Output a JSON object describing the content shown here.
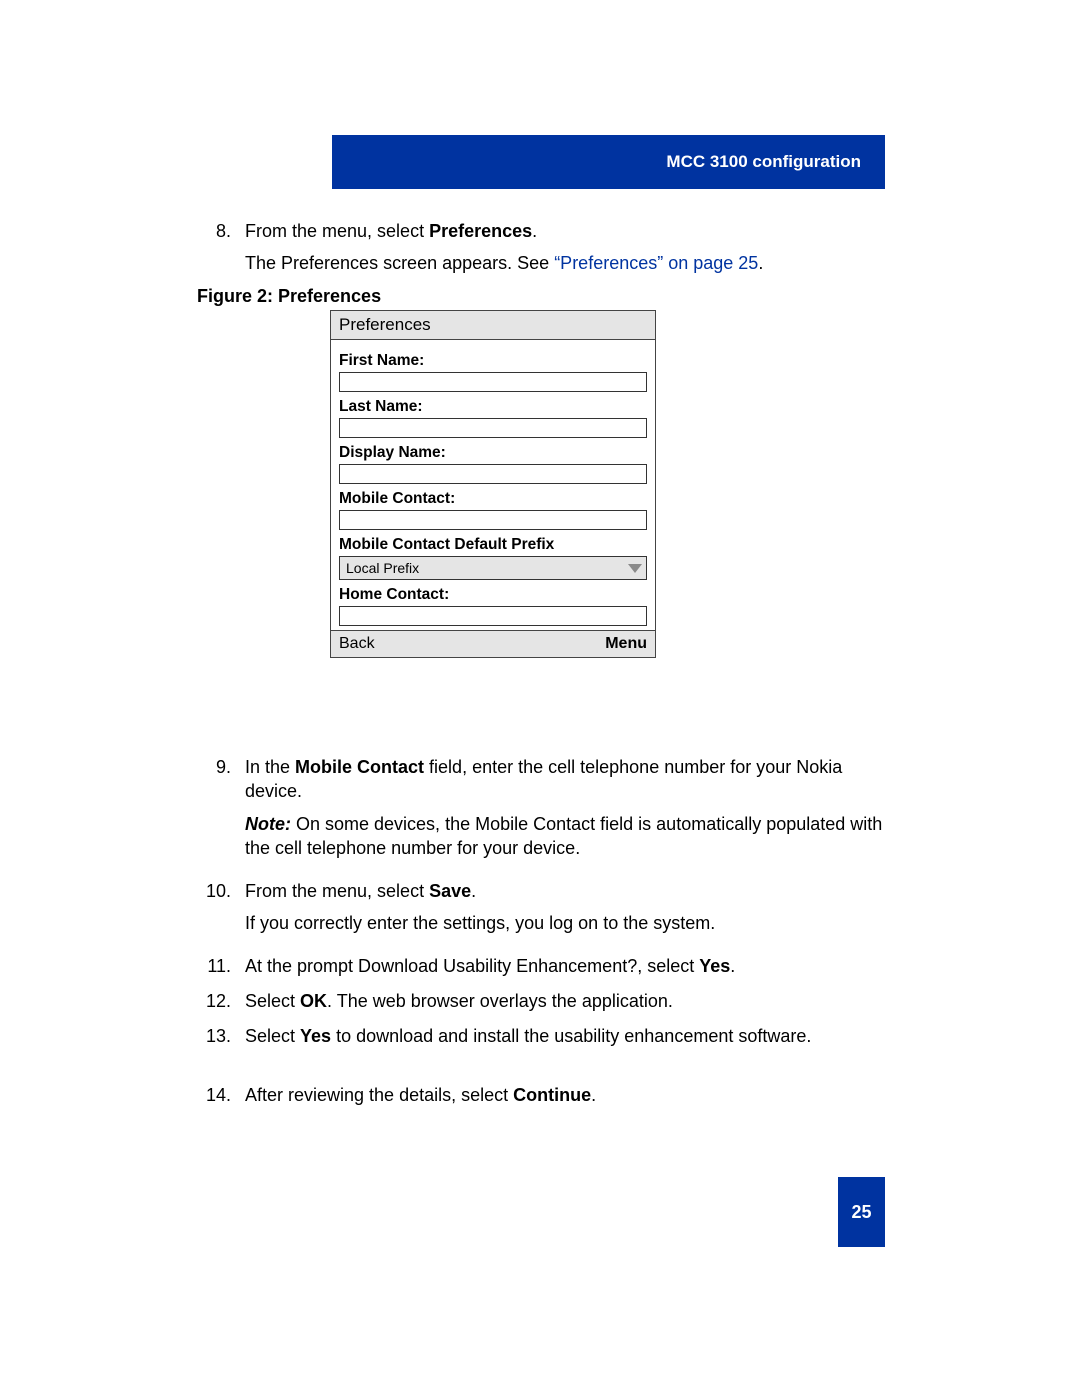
{
  "header": {
    "title": "MCC 3100 configuration"
  },
  "page_number": "25",
  "step8": {
    "num": "8.",
    "text_a": "From the menu, select ",
    "text_b": "Preferences",
    "text_c": ".",
    "sub_a": "The Preferences screen appears. See ",
    "sub_link": "“Preferences” on page 25",
    "sub_b": "."
  },
  "caption": "Figure 2: Preferences",
  "prefs": {
    "title": "Preferences",
    "first_name_label": "First Name:",
    "last_name_label": "Last Name:",
    "display_name_label": "Display Name:",
    "mobile_contact_label": "Mobile Contact:",
    "prefix_label": "Mobile Contact Default Prefix",
    "prefix_value": "Local Prefix",
    "home_contact_label": "Home Contact:",
    "back": "Back",
    "menu": "Menu"
  },
  "step9": {
    "num": "9.",
    "a": "In the ",
    "b": "Mobile Contact",
    "c": " field, enter the cell telephone number for your Nokia device.",
    "note_label": "Note:",
    "note_body": " On some devices, the Mobile Contact field is automatically populated with the cell telephone number for your device."
  },
  "step10": {
    "num": "10.",
    "a": "From the menu, select ",
    "b": "Save",
    "c": ".",
    "sub": "If you correctly enter the settings, you log on to the system."
  },
  "step11": {
    "num": "11.",
    "a": "At the prompt Download Usability Enhancement?, select ",
    "b": "Yes",
    "c": "."
  },
  "step12": {
    "num": "12.",
    "a": "Select ",
    "b": "OK",
    "c": ". The web browser overlays the application."
  },
  "step13": {
    "num": "13.",
    "a": "Select ",
    "b": "Yes",
    "c": " to download and install the usability enhancement software."
  },
  "step14": {
    "num": "14.",
    "a": "After reviewing the details, select ",
    "b": "Continue",
    "c": "."
  }
}
